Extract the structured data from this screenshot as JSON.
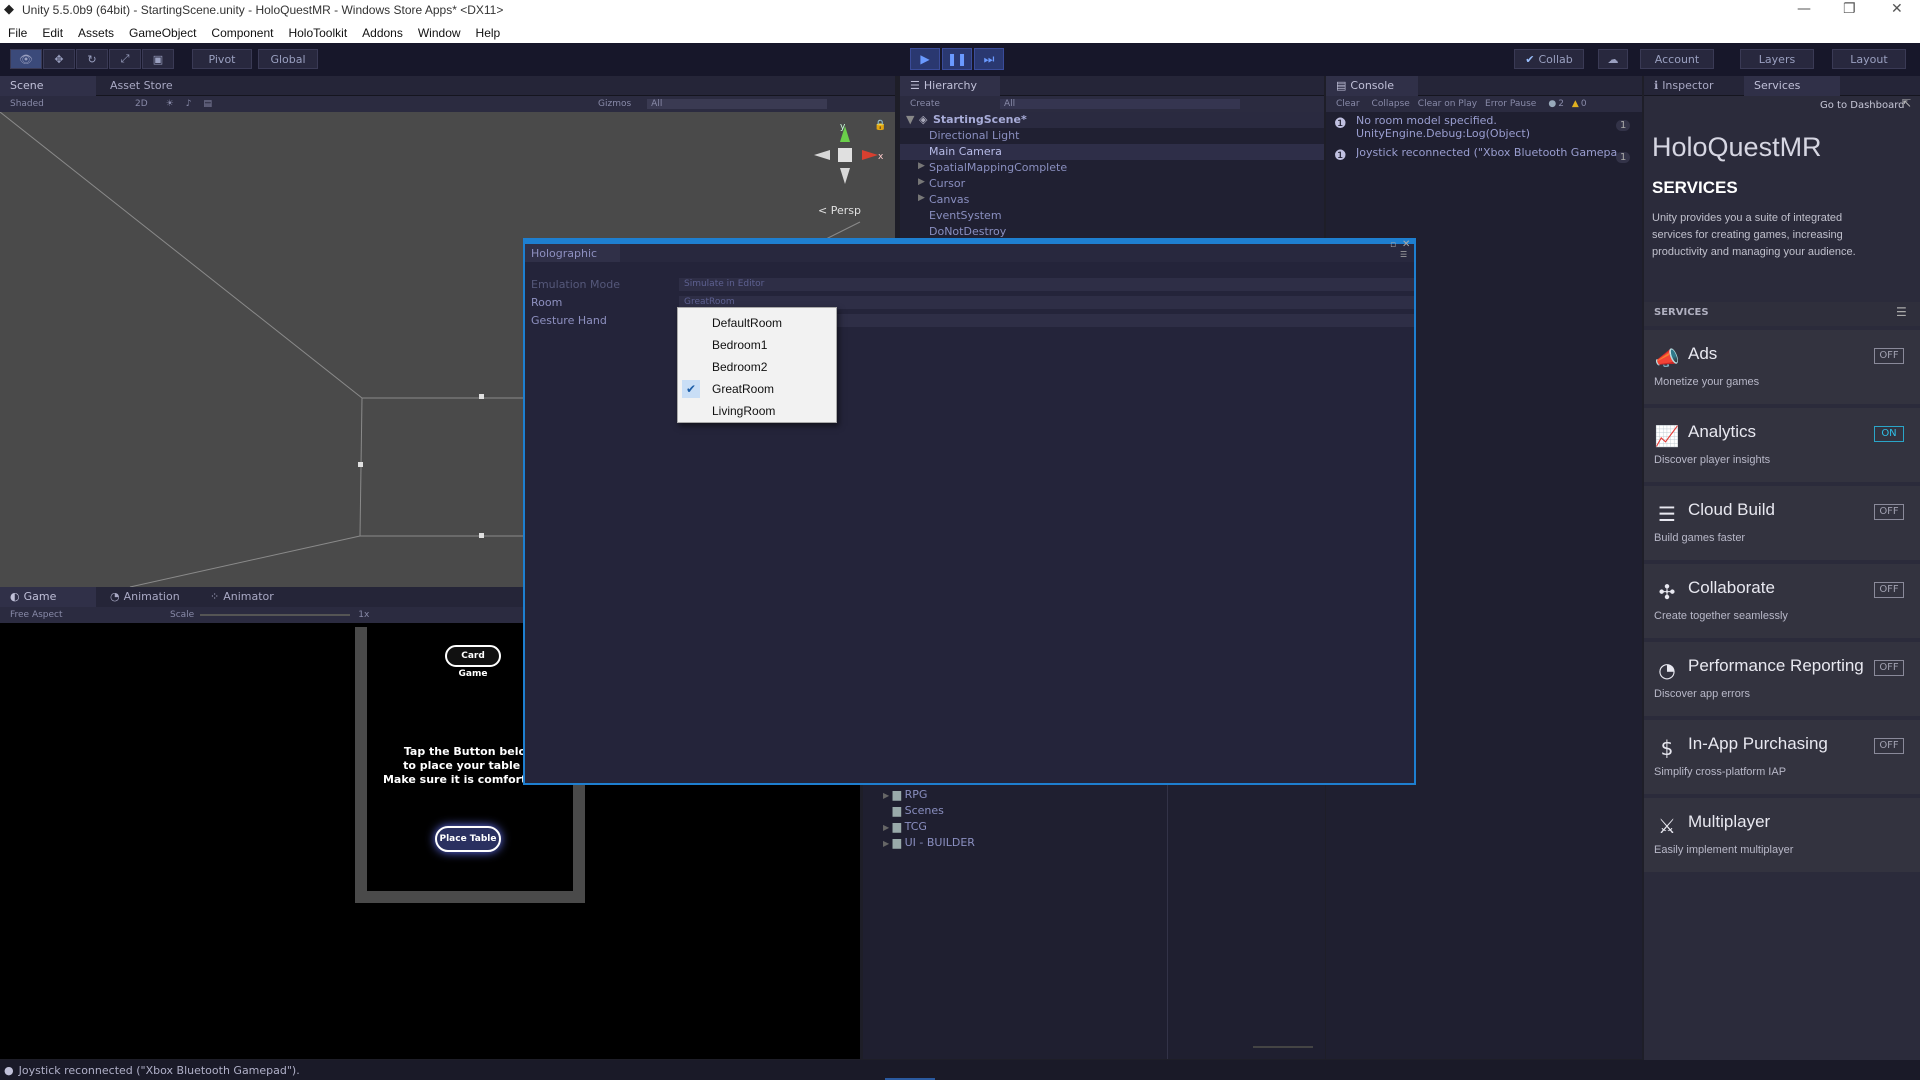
{
  "window": {
    "title": "Unity 5.5.0b9 (64bit) - StartingScene.unity - HoloQuestMR - Windows Store Apps* <DX11>",
    "controls": [
      "—",
      "❐",
      "✕"
    ]
  },
  "menu": [
    "File",
    "Edit",
    "Assets",
    "GameObject",
    "Component",
    "HoloToolkit",
    "Addons",
    "Window",
    "Help"
  ],
  "toolbar": {
    "pivot": "Pivot",
    "global": "Global",
    "collab": "Collab",
    "account": "Account",
    "layers": "Layers",
    "layout": "Layout"
  },
  "scene": {
    "tabs": [
      "Scene",
      "Asset Store"
    ],
    "shading": "Shaded",
    "mode_2d": "2D",
    "gizmos": "Gizmos",
    "search_placeholder": "All",
    "persp_label": "Persp",
    "axis_y": "y",
    "axis_x": "x"
  },
  "hierarchy": {
    "tab": "Hierarchy",
    "create": "Create",
    "search_placeholder": "All",
    "scene_name": "StartingScene*",
    "items": [
      {
        "label": "Directional Light",
        "expandable": false,
        "selected": false
      },
      {
        "label": "Main Camera",
        "expandable": false,
        "selected": true
      },
      {
        "label": "SpatialMappingComplete",
        "expandable": true,
        "selected": false
      },
      {
        "label": "Cursor",
        "expandable": true,
        "selected": false
      },
      {
        "label": "Canvas",
        "expandable": true,
        "selected": false
      },
      {
        "label": "EventSystem",
        "expandable": false,
        "selected": false
      },
      {
        "label": "DoNotDestroy",
        "expandable": false,
        "selected": false
      }
    ]
  },
  "console": {
    "tab": "Console",
    "buttons": [
      "Clear",
      "Collapse",
      "Clear on Play",
      "Error Pause"
    ],
    "info_count": "2",
    "warn_count": "0",
    "entries": [
      {
        "line1": "No room model specified.",
        "line2": "UnityEngine.Debug:Log(Object)",
        "count": "1"
      },
      {
        "line1": "Joystick reconnected (\"Xbox Bluetooth Gamepad\").",
        "line2": "",
        "count": "1"
      }
    ]
  },
  "inspector": {
    "tabs": [
      "Inspector",
      "Services"
    ],
    "dashboard_link": "Go to Dashboard",
    "project_name": "HoloQuestMR",
    "heading": "SERVICES",
    "intro": "Unity provides you a suite of integrated services for creating games, increasing productivity and managing your audience.",
    "section_label": "SERVICES",
    "services": [
      {
        "name": "Ads",
        "desc": "Monetize your games",
        "state": "OFF",
        "icon": "megaphone-icon",
        "glyph": "📣"
      },
      {
        "name": "Analytics",
        "desc": "Discover player insights",
        "state": "ON",
        "icon": "chart-icon",
        "glyph": "📈"
      },
      {
        "name": "Cloud Build",
        "desc": "Build games faster",
        "state": "OFF",
        "icon": "layers-icon",
        "glyph": "☰"
      },
      {
        "name": "Collaborate",
        "desc": "Create together seamlessly",
        "state": "OFF",
        "icon": "network-icon",
        "glyph": "✣"
      },
      {
        "name": "Performance Reporting",
        "desc": "Discover app errors",
        "state": "OFF",
        "icon": "gauge-icon",
        "glyph": "◔"
      },
      {
        "name": "In-App Purchasing",
        "desc": "Simplify cross-platform IAP",
        "state": "OFF",
        "icon": "dollar-icon",
        "glyph": "$"
      },
      {
        "name": "Multiplayer",
        "desc": "Easily implement multiplayer",
        "state": "",
        "icon": "crossed-swords-icon",
        "glyph": "⚔"
      }
    ]
  },
  "game": {
    "tabs": [
      "Game",
      "Animation",
      "Animator"
    ],
    "aspect": "Free Aspect",
    "scale_label": "Scale",
    "scale_value": "1x",
    "card_game_button": "Card Game",
    "instructions_line1": "Tap the Button below",
    "instructions_line2": "to place your table to",
    "instructions_line3": "Make sure it is comfortable.",
    "place_table_button": "Place Table"
  },
  "project": {
    "folders": [
      "RPG",
      "Scenes",
      "TCG",
      "UI - BUILDER"
    ]
  },
  "holographic": {
    "tab": "Holographic",
    "fields": [
      {
        "label": "Emulation Mode",
        "value": "Simulate in Editor"
      },
      {
        "label": "Room",
        "value": "GreatRoom"
      },
      {
        "label": "Gesture Hand",
        "value": ""
      }
    ]
  },
  "room_dropdown": {
    "options": [
      "DefaultRoom",
      "Bedroom1",
      "Bedroom2",
      "GreatRoom",
      "LivingRoom"
    ],
    "selected": "GreatRoom"
  },
  "status": {
    "message": "Joystick reconnected (\"Xbox Bluetooth Gamepad\")."
  }
}
